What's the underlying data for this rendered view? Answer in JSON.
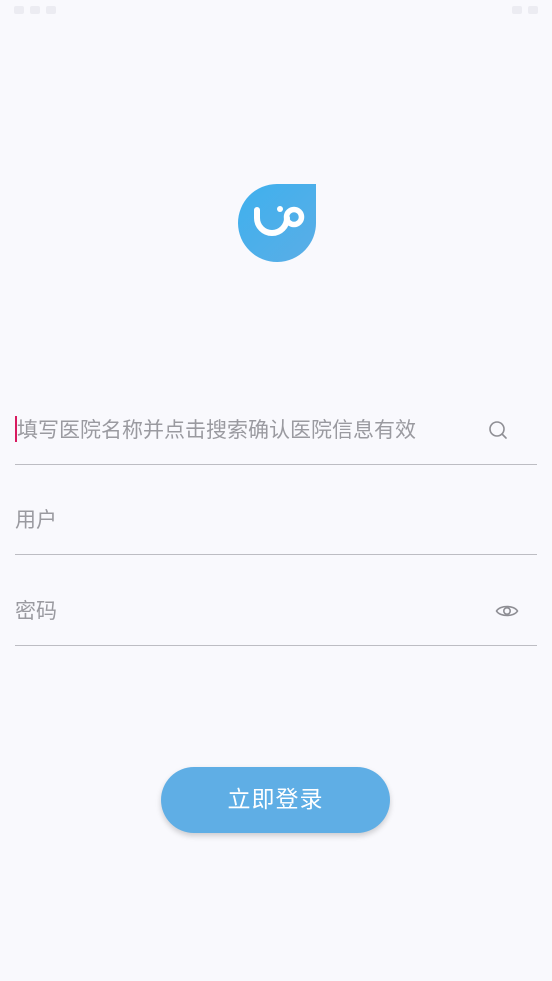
{
  "colors": {
    "background": "#f9f9fd",
    "accent": "#5faee5",
    "logo_blue": "#4aa8e8",
    "divider": "#bdbdc3",
    "placeholder": "#9a9aa0",
    "caret": "#d81b60"
  },
  "logo": {
    "icon": "stethoscope-smile-logo"
  },
  "form": {
    "hospital": {
      "placeholder": "填写医院名称并点击搜索确认医院信息有效",
      "value": "",
      "icon": "search-icon"
    },
    "user": {
      "placeholder": "用户",
      "value": ""
    },
    "password": {
      "placeholder": "密码",
      "value": "",
      "icon": "eye-icon"
    },
    "login_label": "立即登录"
  }
}
